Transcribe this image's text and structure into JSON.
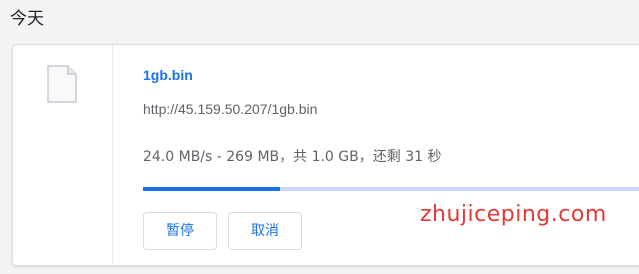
{
  "section": {
    "date_heading": "今天"
  },
  "download": {
    "file_name": "1gb.bin",
    "url": "http://45.159.50.207/1gb.bin",
    "status": "24.0 MB/s - 269 MB，共 1.0 GB，还剩 31 秒",
    "progress_fraction": 0.269,
    "icon": "file-icon",
    "buttons": {
      "pause": "暂停",
      "cancel": "取消"
    }
  },
  "watermark": {
    "text": "zhujiceping.com",
    "color": "#e53935"
  },
  "colors": {
    "accent": "#1a73e8",
    "progress_track": "#c8d9f7"
  }
}
